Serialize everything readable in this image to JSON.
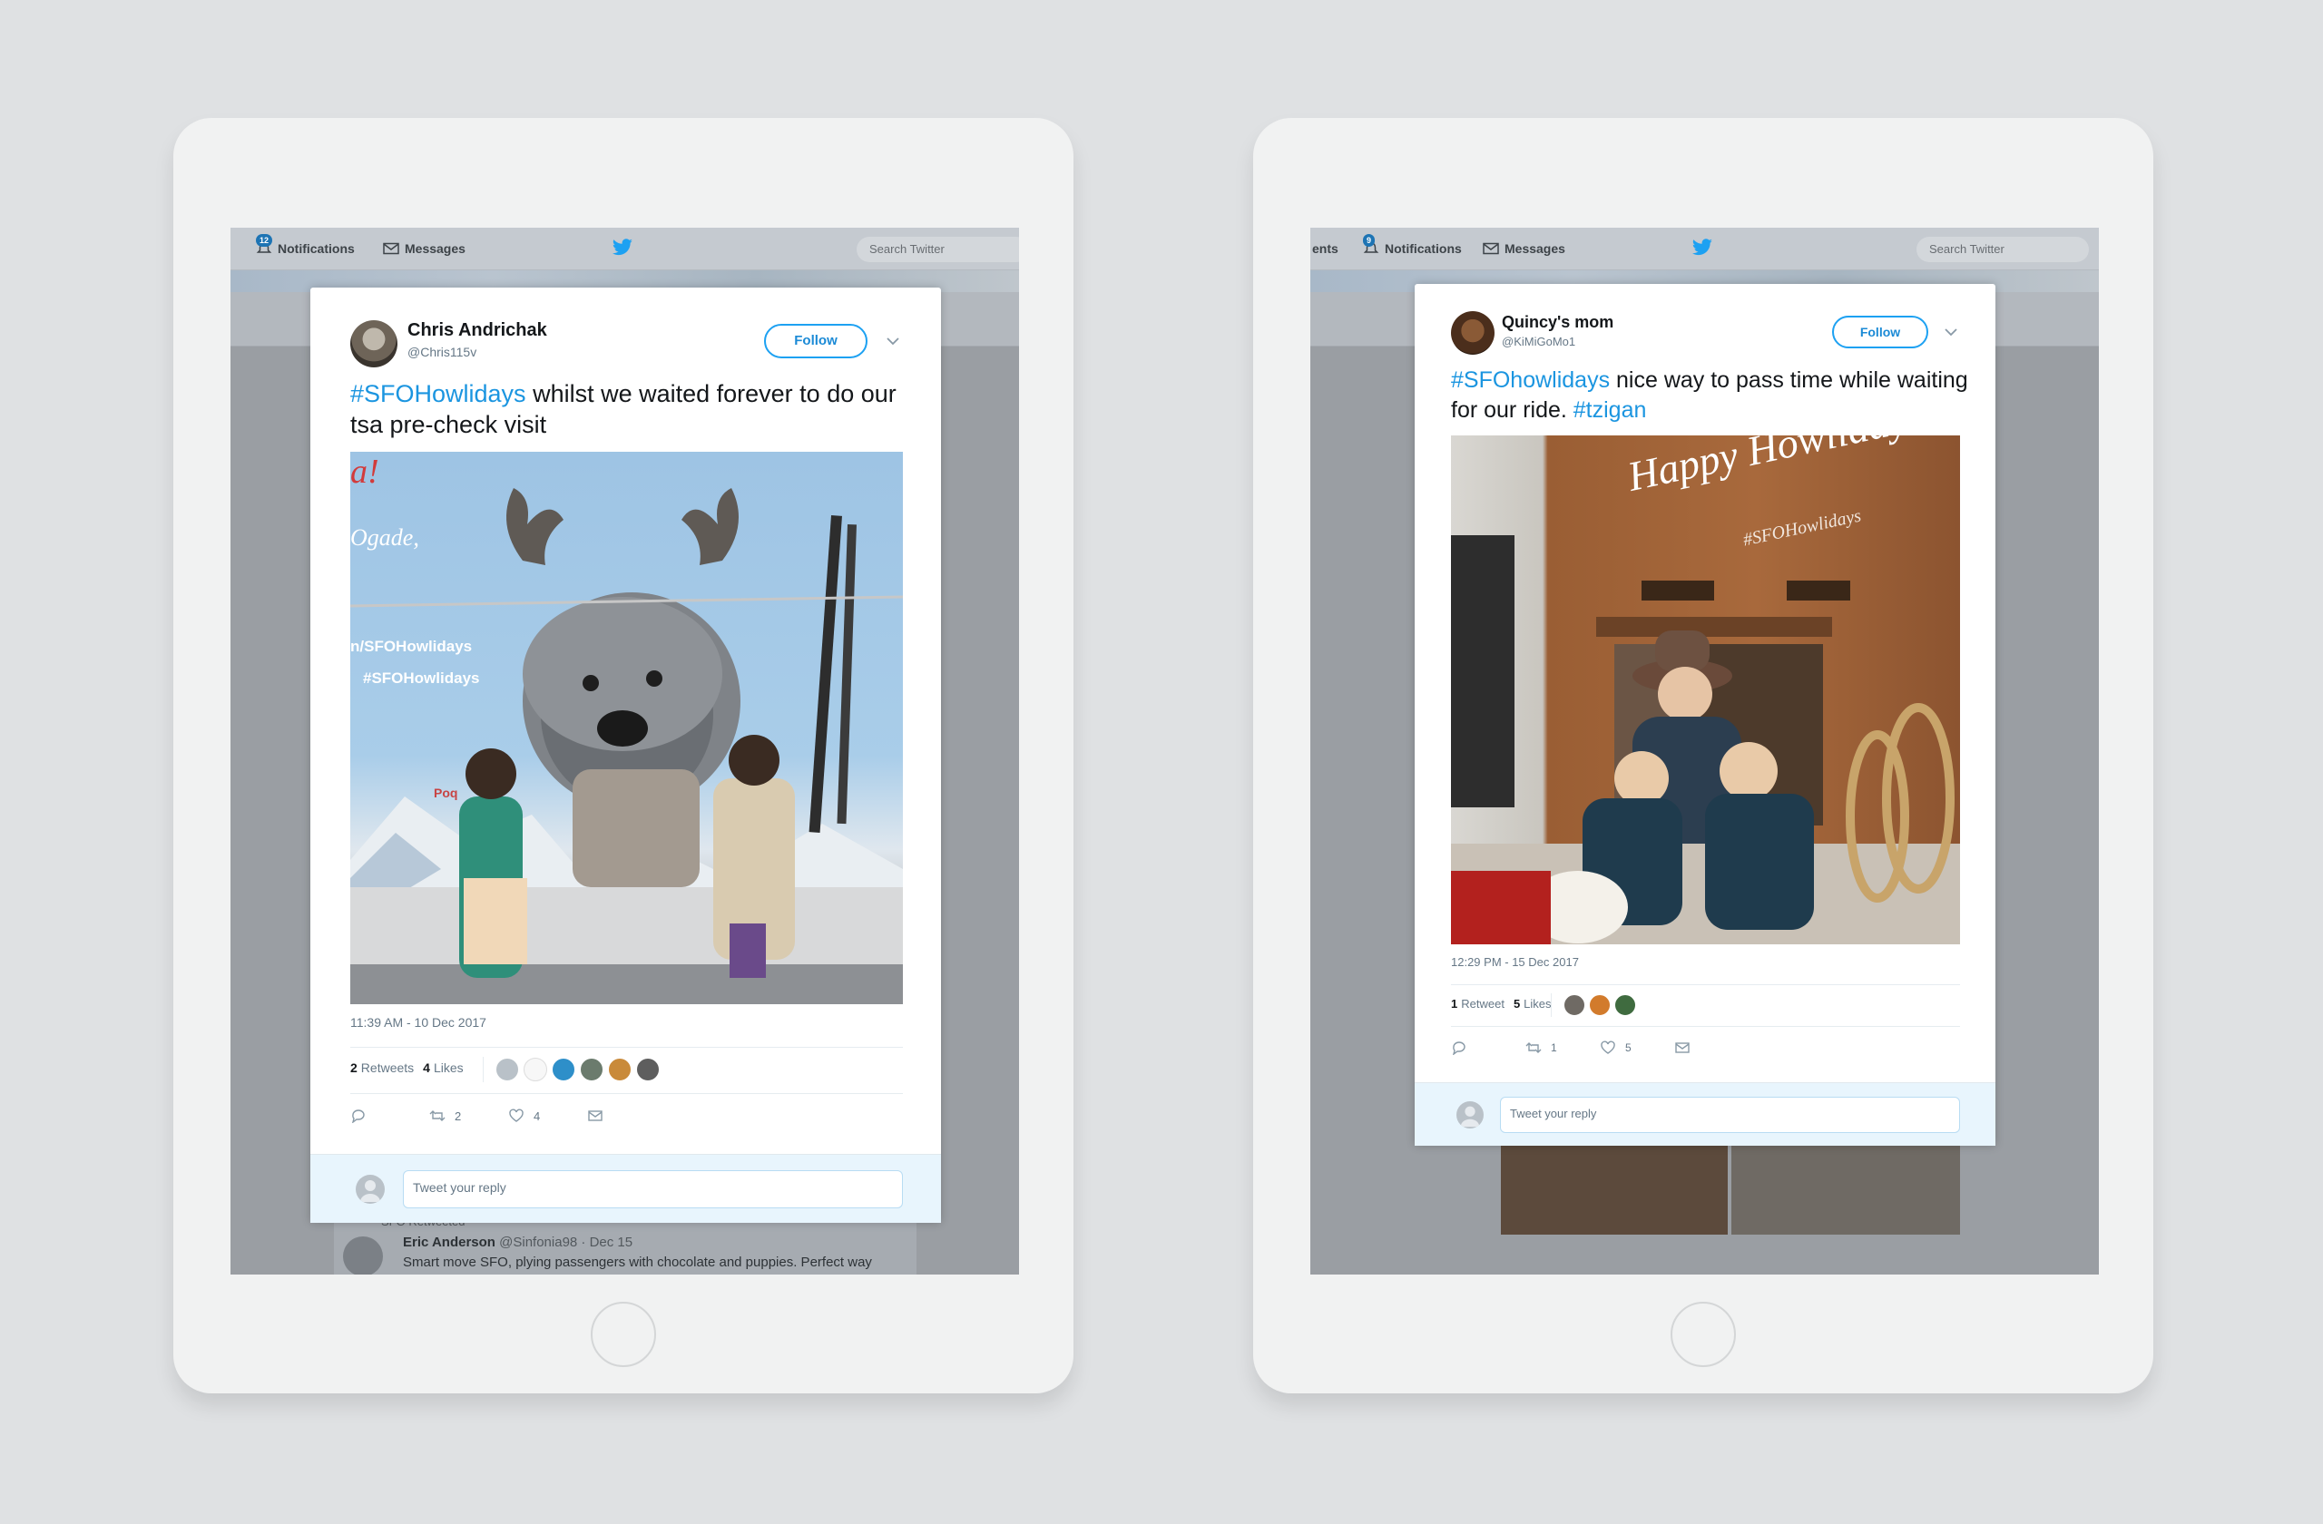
{
  "tablets": [
    {
      "nav": {
        "notifications_label": "Notifications",
        "notifications_badge": "12",
        "messages_label": "Messages",
        "search_placeholder": "Search Twitter"
      },
      "tweet": {
        "name": "Chris Andrichak",
        "handle": "@Chris115v",
        "follow_label": "Follow",
        "hashtag": "#SFOHowlidays",
        "text": " whilst we waited forever to do our tsa pre-check visit",
        "timestamp": "11:39 AM - 10 Dec 2017",
        "retweets_count": "2",
        "retweets_label": "Retweets",
        "likes_count": "4",
        "likes_label": "Likes",
        "action_retweet_count": "2",
        "action_like_count": "4",
        "reply_placeholder": "Tweet your reply",
        "photo_text": {
          "line1": "n/SFOHowlidays",
          "line2": "#SFOHowlidays",
          "edge": "Ogade,",
          "poq": "Poq",
          "corner": "a!"
        }
      },
      "background_tweet": {
        "retweeted_label": "SFO Retweeted",
        "name": "Eric Anderson",
        "handle_time": "@Sinfonia98 · Dec 15",
        "text": "Smart move SFO, plying passengers with chocolate and puppies. Perfect way"
      }
    },
    {
      "nav": {
        "edge_label": "ents",
        "notifications_label": "Notifications",
        "notifications_badge": "9",
        "messages_label": "Messages",
        "search_placeholder": "Search Twitter"
      },
      "tweet": {
        "name": "Quincy's mom",
        "handle": "@KiMiGoMo1",
        "follow_label": "Follow",
        "hashtag": "#SFOhowlidays",
        "text": " nice way to pass time while waiting for our ride. ",
        "hashtag2": "#tzigan",
        "timestamp": "12:29 PM - 15 Dec 2017",
        "retweets_count": "1",
        "retweets_label": "Retweet",
        "likes_count": "5",
        "likes_label": "Likes",
        "action_retweet_count": "1",
        "action_like_count": "5",
        "reply_placeholder": "Tweet your reply",
        "photo_text": {
          "title": "Happy Howlidays!",
          "subtitle": "#SFOHowlidays"
        }
      }
    }
  ],
  "colors": {
    "twitter_blue": "#1da1f2",
    "hashtag_blue": "#1b95e0",
    "page_background": "#dfe1e3",
    "tablet_body": "#f1f2f2"
  },
  "icons": [
    "bell-icon",
    "mail-icon",
    "twitter-bird-icon",
    "chevron-down-icon",
    "reply-icon",
    "retweet-icon",
    "heart-icon",
    "direct-message-icon",
    "default-avatar-icon"
  ]
}
